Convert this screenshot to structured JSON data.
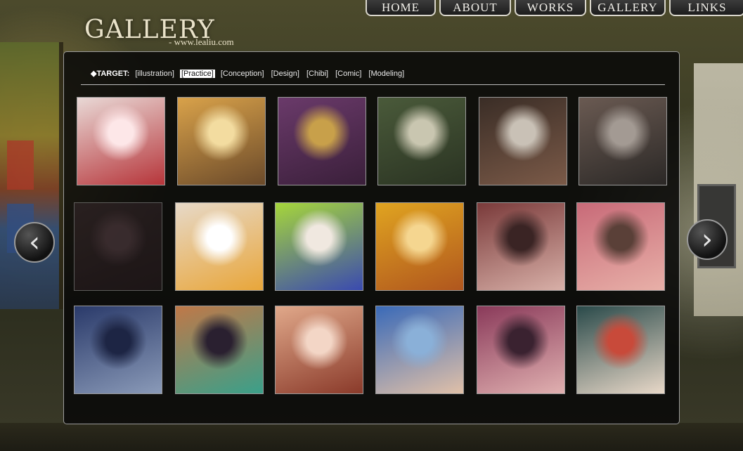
{
  "header": {
    "title": "GALLERY",
    "site": "- www.lealiu.com"
  },
  "nav": {
    "items": [
      {
        "label": "HOME"
      },
      {
        "label": "ABOUT"
      },
      {
        "label": "WORKS"
      },
      {
        "label": "GALLERY"
      },
      {
        "label": "LINKS"
      }
    ]
  },
  "filter": {
    "label": "◆TARGET:",
    "items": [
      {
        "label": "[illustration]",
        "active": false
      },
      {
        "label": "[Practice]",
        "active": true
      },
      {
        "label": "[Conception]",
        "active": false
      },
      {
        "label": "[Design]",
        "active": false
      },
      {
        "label": "[Chibi]",
        "active": false
      },
      {
        "label": "[Comic]",
        "active": false
      },
      {
        "label": "[Modeling]",
        "active": false
      }
    ]
  },
  "thumbnails": [
    {
      "colors": [
        "#e9d9d6",
        "#b6353a",
        "#fde7e8"
      ],
      "dim": false
    },
    {
      "colors": [
        "#d9a24a",
        "#6b4a2a",
        "#f3dca0"
      ],
      "dim": false
    },
    {
      "colors": [
        "#6a3a6a",
        "#3a1f3a",
        "#c8a04a"
      ],
      "dim": false
    },
    {
      "colors": [
        "#4a5a3a",
        "#2a3322",
        "#c9c6b0"
      ],
      "dim": false
    },
    {
      "colors": [
        "#3a2d26",
        "#7b5a48",
        "#c9c1b6"
      ],
      "dim": false
    },
    {
      "colors": [
        "#6a5a52",
        "#2b2826",
        "#a39a93"
      ],
      "dim": false
    },
    {
      "colors": [
        "#3a2a2e",
        "#2a1d20",
        "#5a4248"
      ],
      "dim": true
    },
    {
      "colors": [
        "#e7d9c8",
        "#e8a63a",
        "#ffffff"
      ],
      "dim": false
    },
    {
      "colors": [
        "#a6d63a",
        "#3a4ab0",
        "#f0e8e0"
      ],
      "dim": false
    },
    {
      "colors": [
        "#e0a420",
        "#b0561e",
        "#f5d690"
      ],
      "dim": false
    },
    {
      "colors": [
        "#7a3a3a",
        "#d8b0a8",
        "#3a2424"
      ],
      "dim": false
    },
    {
      "colors": [
        "#c86a78",
        "#e8b0a8",
        "#5a4038"
      ],
      "dim": false
    },
    {
      "colors": [
        "#2a3a6a",
        "#8a9ab8",
        "#1d2544"
      ],
      "dim": false
    },
    {
      "colors": [
        "#c07848",
        "#3aa08a",
        "#2a2030"
      ],
      "dim": false
    },
    {
      "colors": [
        "#e0a88a",
        "#8a3a2a",
        "#f3d6c6"
      ],
      "dim": false
    },
    {
      "colors": [
        "#3a6ab8",
        "#e0c0a8",
        "#8ab0d8"
      ],
      "dim": false
    },
    {
      "colors": [
        "#8a3a5a",
        "#e0b0b0",
        "#3a2230"
      ],
      "dim": false
    },
    {
      "colors": [
        "#2a4a4a",
        "#e8d8c8",
        "#c84a3a"
      ],
      "dim": false
    }
  ],
  "arrows": {
    "prev": "‹",
    "next": "›"
  }
}
